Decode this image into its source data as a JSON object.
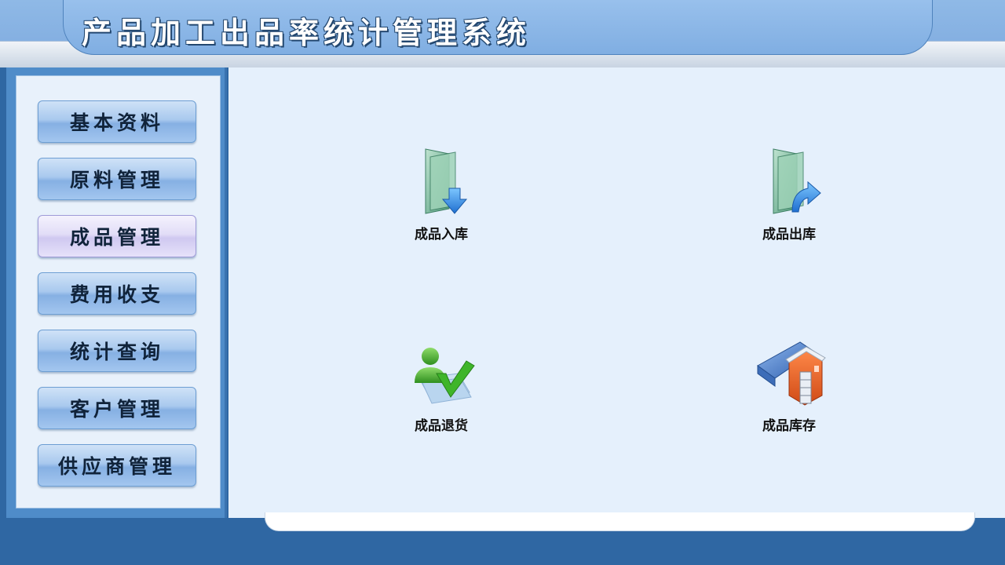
{
  "header": {
    "title": "产品加工出品率统计管理系统"
  },
  "sidebar": {
    "active_index": 2,
    "items": [
      {
        "label": "基本资料"
      },
      {
        "label": "原料管理"
      },
      {
        "label": "成品管理"
      },
      {
        "label": "费用收支"
      },
      {
        "label": "统计查询"
      },
      {
        "label": "客户管理"
      },
      {
        "label": "供应商管理"
      }
    ]
  },
  "main": {
    "features": [
      {
        "label": "成品入库",
        "icon": "folder-download-icon"
      },
      {
        "label": "成品出库",
        "icon": "folder-export-icon"
      },
      {
        "label": "成品退货",
        "icon": "user-return-check-icon"
      },
      {
        "label": "成品库存",
        "icon": "warehouse-icon"
      }
    ]
  },
  "colors": {
    "header": "#8fb9e6",
    "sidebar": "#4f8cc9",
    "main_background": "#e5f0fc",
    "active_button": "#e2ddf7",
    "frame": "#2f67a3"
  }
}
